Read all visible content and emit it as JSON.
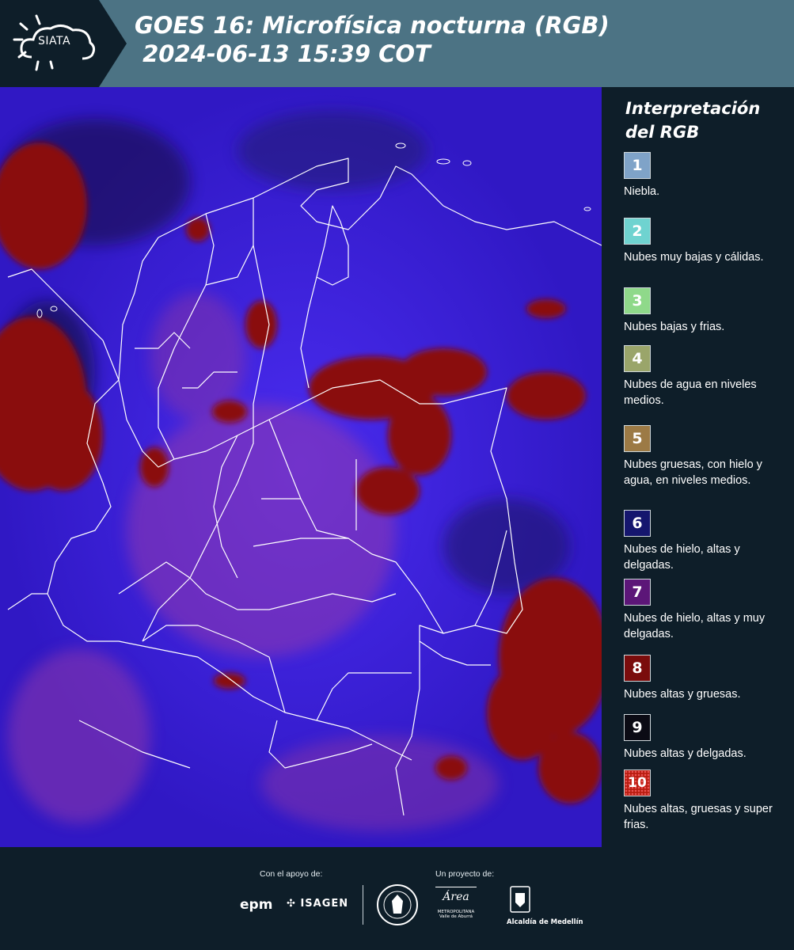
{
  "header": {
    "logo_text": "SIATA",
    "title": "GOES 16: Microfísica nocturna (RGB)\n 2024-06-13 15:39 COT"
  },
  "legend": {
    "title": "Interpretación del RGB",
    "items": [
      {
        "number": "1",
        "label": "Niebla.",
        "color": "#7fa3c8"
      },
      {
        "number": "2",
        "label": "Nubes muy bajas y cálidas.",
        "color": "#6fd3d0"
      },
      {
        "number": "3",
        "label": "Nubes bajas y frias.",
        "color": "#8fd98a"
      },
      {
        "number": "4",
        "label": "Nubes de agua en niveles medios.",
        "color": "#9aa56a"
      },
      {
        "number": "5",
        "label": "Nubes gruesas, con hielo y agua, en niveles medios.",
        "color": "#9c7a45"
      },
      {
        "number": "6",
        "label": "Nubes de hielo, altas y delgadas.",
        "color": "#15166e"
      },
      {
        "number": "7",
        "label": "Nubes de hielo, altas y muy delgadas.",
        "color": "#5c1678"
      },
      {
        "number": "8",
        "label": "Nubes altas y gruesas.",
        "color": "#7a0c0c"
      },
      {
        "number": "9",
        "label": "Nubes altas y delgadas.",
        "color": "#0b0b14"
      },
      {
        "number": "10",
        "label": "Nubes altas, gruesas y super frias.",
        "color": "#b81d10"
      }
    ]
  },
  "footer": {
    "support_label": "Con el apoyo de:",
    "project_label": "Un proyecto de:",
    "sponsor_epm": "epm",
    "sponsor_isagen": "ISAGEN",
    "area_line1": "Área",
    "area_line2": "METROPOLITANA",
    "area_line3": "Valle de Aburrá",
    "alcaldia": "Alcaldía de Medellín"
  },
  "colors": {
    "header_bg": "#4c7384",
    "page_bg": "#0e1e29",
    "map_blue": "#3a1fd8",
    "map_red": "#8a0808",
    "border_white": "#ffffff"
  }
}
